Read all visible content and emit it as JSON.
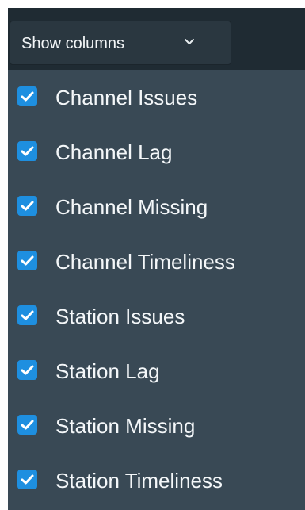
{
  "dropdown": {
    "label": "Show columns",
    "icon": "chevron-down-icon"
  },
  "colors": {
    "checkbox": "#1e8fe0",
    "panel": "#394955",
    "topbar": "#1f2b33"
  },
  "columns": [
    {
      "label": "Channel Issues",
      "checked": true
    },
    {
      "label": "Channel Lag",
      "checked": true
    },
    {
      "label": "Channel Missing",
      "checked": true
    },
    {
      "label": "Channel Timeliness",
      "checked": true
    },
    {
      "label": "Station Issues",
      "checked": true
    },
    {
      "label": "Station Lag",
      "checked": true
    },
    {
      "label": "Station Missing",
      "checked": true
    },
    {
      "label": "Station Timeliness",
      "checked": true
    }
  ]
}
